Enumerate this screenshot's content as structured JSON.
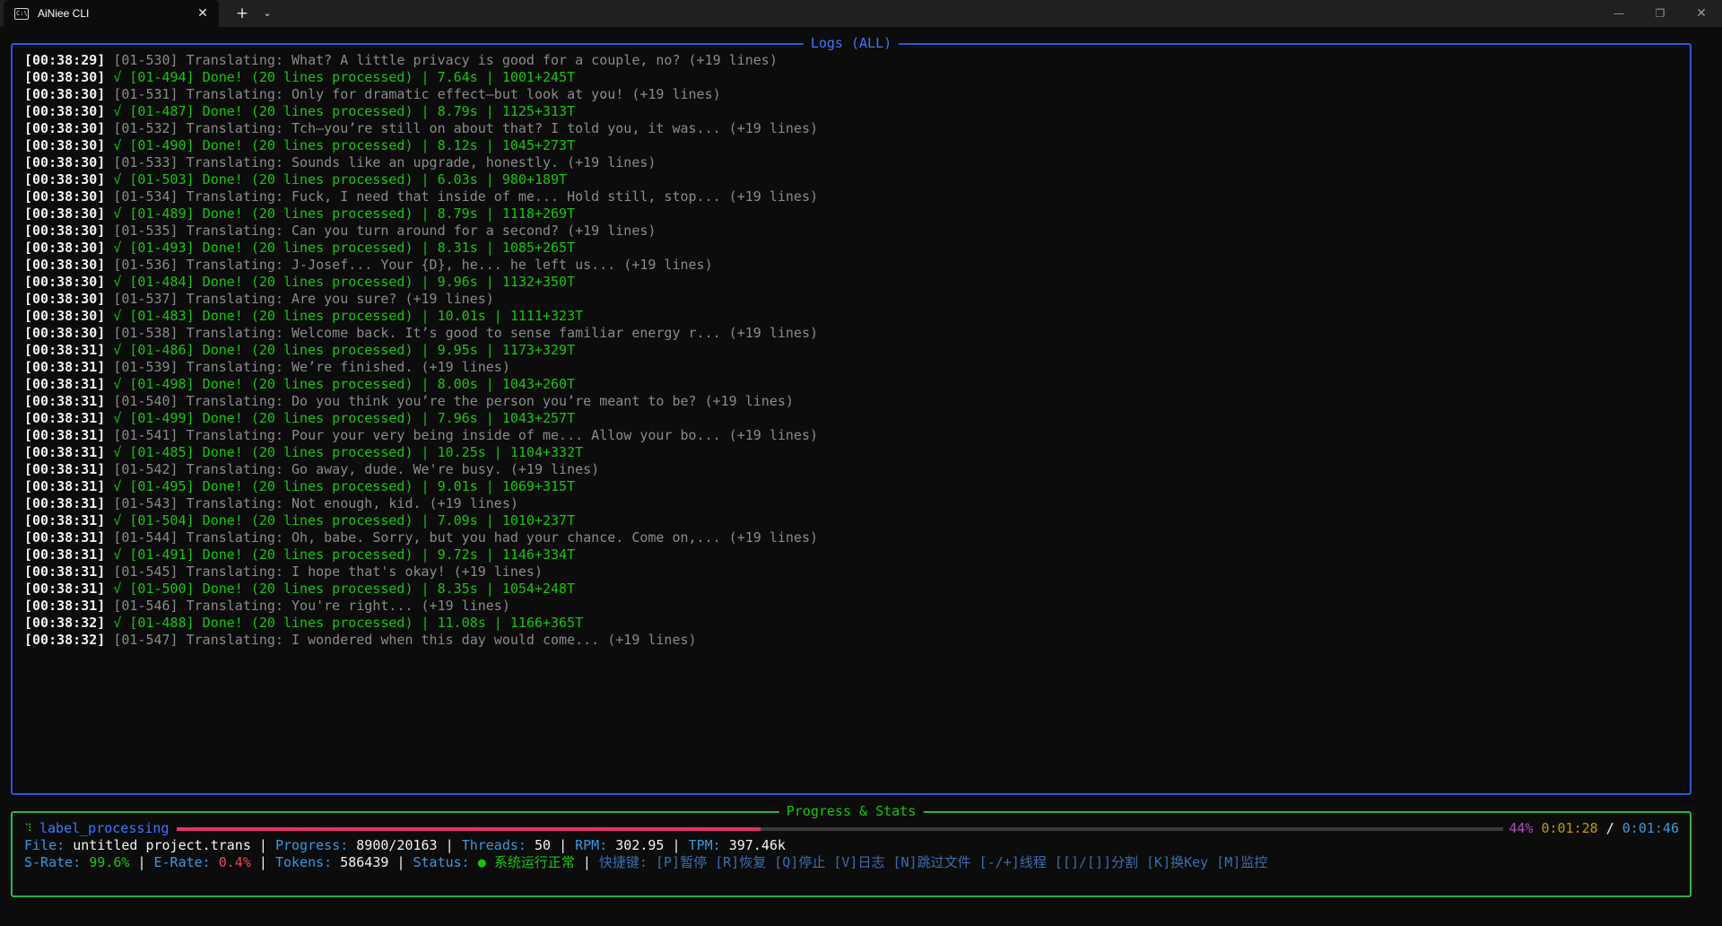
{
  "window": {
    "tab_title": "AiNiee CLI",
    "tab_icon_text": "C:\\_",
    "close_tab_glyph": "✕",
    "new_tab_glyph": "+",
    "tab_menu_glyph": "⌄",
    "minimize_glyph": "—",
    "maximize_glyph": "❐",
    "close_glyph": "✕"
  },
  "logs": {
    "title": "Logs (ALL)",
    "lines": [
      {
        "ts": "[00:38:29]",
        "text": "[01-530] Translating: What? A little privacy is good for a couple, no? (+19 lines)",
        "kind": "translating"
      },
      {
        "ts": "[00:38:30]",
        "text": "√ [01-494] Done! (20 lines processed) | 7.64s | 1001+245T",
        "kind": "done"
      },
      {
        "ts": "[00:38:30]",
        "text": "[01-531] Translating: Only for dramatic effect—but look at you! (+19 lines)",
        "kind": "translating"
      },
      {
        "ts": "[00:38:30]",
        "text": "√ [01-487] Done! (20 lines processed) | 8.79s | 1125+313T",
        "kind": "done"
      },
      {
        "ts": "[00:38:30]",
        "text": "[01-532] Translating: Tch—you’re still on about that? I told you, it was... (+19 lines)",
        "kind": "translating"
      },
      {
        "ts": "[00:38:30]",
        "text": "√ [01-490] Done! (20 lines processed) | 8.12s | 1045+273T",
        "kind": "done"
      },
      {
        "ts": "[00:38:30]",
        "text": "[01-533] Translating: Sounds like an upgrade, honestly. (+19 lines)",
        "kind": "translating"
      },
      {
        "ts": "[00:38:30]",
        "text": "√ [01-503] Done! (20 lines processed) | 6.03s | 980+189T",
        "kind": "done"
      },
      {
        "ts": "[00:38:30]",
        "text": "[01-534] Translating: Fuck, I need that inside of me... Hold still, stop... (+19 lines)",
        "kind": "translating"
      },
      {
        "ts": "[00:38:30]",
        "text": "√ [01-489] Done! (20 lines processed) | 8.79s | 1118+269T",
        "kind": "done"
      },
      {
        "ts": "[00:38:30]",
        "text": "[01-535] Translating: Can you turn around for a second? (+19 lines)",
        "kind": "translating"
      },
      {
        "ts": "[00:38:30]",
        "text": "√ [01-493] Done! (20 lines processed) | 8.31s | 1085+265T",
        "kind": "done"
      },
      {
        "ts": "[00:38:30]",
        "text": "[01-536] Translating: J-Josef... Your {D}, he... he left us... (+19 lines)",
        "kind": "translating"
      },
      {
        "ts": "[00:38:30]",
        "text": "√ [01-484] Done! (20 lines processed) | 9.96s | 1132+350T",
        "kind": "done"
      },
      {
        "ts": "[00:38:30]",
        "text": "[01-537] Translating: Are you sure? (+19 lines)",
        "kind": "translating"
      },
      {
        "ts": "[00:38:30]",
        "text": "√ [01-483] Done! (20 lines processed) | 10.01s | 1111+323T",
        "kind": "done"
      },
      {
        "ts": "[00:38:30]",
        "text": "[01-538] Translating: Welcome back. It’s good to sense familiar energy r... (+19 lines)",
        "kind": "translating"
      },
      {
        "ts": "[00:38:31]",
        "text": "√ [01-486] Done! (20 lines processed) | 9.95s | 1173+329T",
        "kind": "done"
      },
      {
        "ts": "[00:38:31]",
        "text": "[01-539] Translating: We’re finished. (+19 lines)",
        "kind": "translating"
      },
      {
        "ts": "[00:38:31]",
        "text": "√ [01-498] Done! (20 lines processed) | 8.00s | 1043+260T",
        "kind": "done"
      },
      {
        "ts": "[00:38:31]",
        "text": "[01-540] Translating: Do you think you’re the person you’re meant to be? (+19 lines)",
        "kind": "translating"
      },
      {
        "ts": "[00:38:31]",
        "text": "√ [01-499] Done! (20 lines processed) | 7.96s | 1043+257T",
        "kind": "done"
      },
      {
        "ts": "[00:38:31]",
        "text": "[01-541] Translating: Pour your very being inside of me... Allow your bo... (+19 lines)",
        "kind": "translating"
      },
      {
        "ts": "[00:38:31]",
        "text": "√ [01-485] Done! (20 lines processed) | 10.25s | 1104+332T",
        "kind": "done"
      },
      {
        "ts": "[00:38:31]",
        "text": "[01-542] Translating: Go away, dude. We're busy. (+19 lines)",
        "kind": "translating"
      },
      {
        "ts": "[00:38:31]",
        "text": "√ [01-495] Done! (20 lines processed) | 9.01s | 1069+315T",
        "kind": "done"
      },
      {
        "ts": "[00:38:31]",
        "text": "[01-543] Translating: Not enough, kid. (+19 lines)",
        "kind": "translating"
      },
      {
        "ts": "[00:38:31]",
        "text": "√ [01-504] Done! (20 lines processed) | 7.09s | 1010+237T",
        "kind": "done"
      },
      {
        "ts": "[00:38:31]",
        "text": "[01-544] Translating: Oh, babe. Sorry, but you had your chance. Come on,... (+19 lines)",
        "kind": "translating"
      },
      {
        "ts": "[00:38:31]",
        "text": "√ [01-491] Done! (20 lines processed) | 9.72s | 1146+334T",
        "kind": "done"
      },
      {
        "ts": "[00:38:31]",
        "text": "[01-545] Translating: I hope that's okay! (+19 lines)",
        "kind": "translating"
      },
      {
        "ts": "[00:38:31]",
        "text": "√ [01-500] Done! (20 lines processed) | 8.35s | 1054+248T",
        "kind": "done"
      },
      {
        "ts": "[00:38:31]",
        "text": "[01-546] Translating: You're right... (+19 lines)",
        "kind": "translating"
      },
      {
        "ts": "[00:38:32]",
        "text": "√ [01-488] Done! (20 lines processed) | 11.08s | 1166+365T",
        "kind": "done"
      },
      {
        "ts": "[00:38:32]",
        "text": "[01-547] Translating: I wondered when this day would come... (+19 lines)",
        "kind": "translating"
      }
    ]
  },
  "stats": {
    "title": "Progress & Stats",
    "spinner": "⠹",
    "task_label": "label_processing",
    "progress_fraction": 0.44,
    "percent": "44%",
    "elapsed": "0:01:28",
    "time_separator": "/",
    "remaining": "0:01:46",
    "file_label": "File:",
    "file_value": "untitled project.trans",
    "progress_label": "Progress:",
    "progress_value": "8900/20163",
    "threads_label": "Threads:",
    "threads_value": "50",
    "rpm_label": "RPM:",
    "rpm_value": "302.95",
    "tpm_label": "TPM:",
    "tpm_value": "397.46k",
    "srate_label": "S-Rate:",
    "srate_value": "99.6%",
    "erate_label": "E-Rate:",
    "erate_value": "0.4%",
    "tokens_label": "Tokens:",
    "tokens_value": "586439",
    "status_label": "Status:",
    "status_dot": "●",
    "status_value": "系统运行正常",
    "shortcuts": "快捷键: [P]暂停 [R]恢复 [Q]停止 [V]日志 [N]跳过文件 [-/+]线程 [[]/[]]分割 [K]换Key [M]监控",
    "divider": "|"
  },
  "colors": {
    "logs_border": "#2b57d6",
    "stats_border": "#2db34a",
    "done_text": "#16c60c",
    "translating_text": "#8a8a8a",
    "progress_fill": "#e5326a"
  }
}
